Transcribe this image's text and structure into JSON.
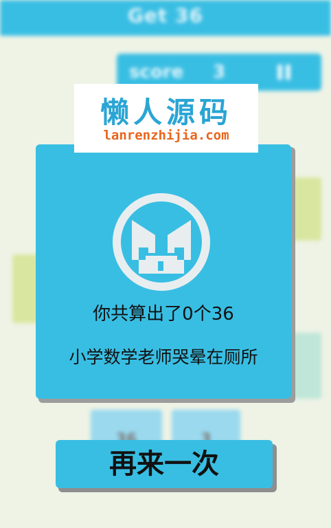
{
  "header": {
    "title": "Get 36"
  },
  "score": {
    "label": "score",
    "value": "3"
  },
  "board": {
    "tiles": [
      {
        "value": "36",
        "color": "tile-blue"
      },
      {
        "value": "3",
        "color": "tile-blue"
      }
    ]
  },
  "watermark": {
    "name": "懒人源码",
    "url": "lanrenzhijia.com"
  },
  "result": {
    "line1": "你共算出了0个36",
    "line2": "小学数学老师哭晕在厕所"
  },
  "retry": {
    "label": "再来一次"
  },
  "colors": {
    "accent": "#39bee3",
    "background": "#eef3e6"
  }
}
